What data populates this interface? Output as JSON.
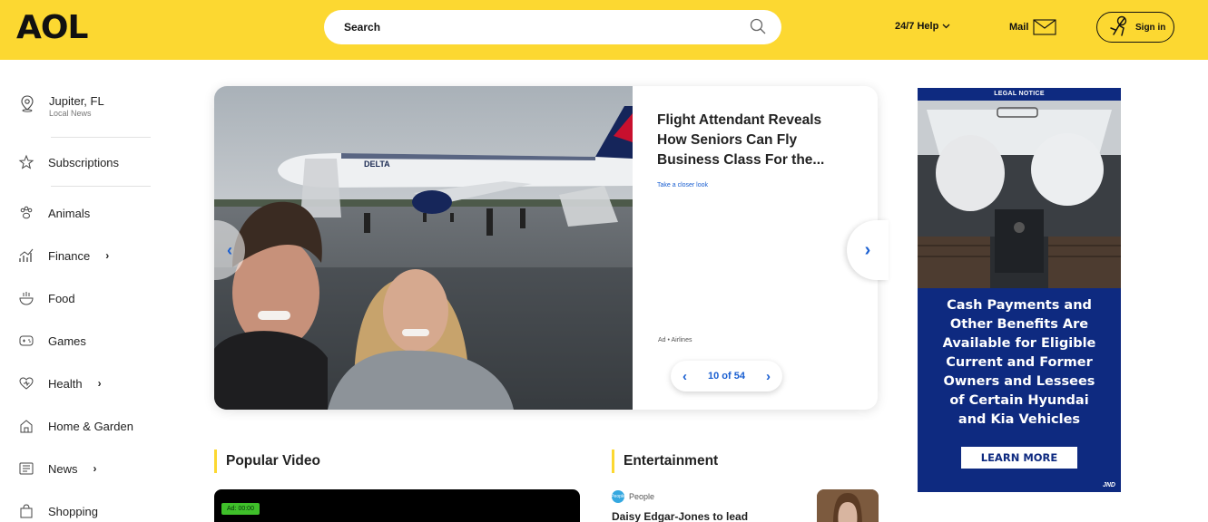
{
  "header": {
    "logo": "AOL",
    "search_placeholder": "Search",
    "help_label": "24/7 Help",
    "mail_label": "Mail",
    "signin_label": "Sign in",
    "colors": {
      "bg": "#fcd831"
    }
  },
  "sidebar": {
    "location": {
      "city": "Jupiter, FL",
      "sub": "Local News"
    },
    "subscriptions": "Subscriptions",
    "items": [
      {
        "label": "Animals",
        "icon": "paw-icon",
        "has_chevron": false
      },
      {
        "label": "Finance",
        "icon": "finance-chart-icon",
        "has_chevron": true
      },
      {
        "label": "Food",
        "icon": "bowl-icon",
        "has_chevron": false
      },
      {
        "label": "Games",
        "icon": "gamepad-icon",
        "has_chevron": false
      },
      {
        "label": "Health",
        "icon": "heart-icon",
        "has_chevron": true
      },
      {
        "label": "Home & Garden",
        "icon": "house-icon",
        "has_chevron": false
      },
      {
        "label": "News",
        "icon": "newspaper-icon",
        "has_chevron": true
      },
      {
        "label": "Shopping",
        "icon": "shopping-bag-icon",
        "has_chevron": false
      }
    ],
    "chevron": "›"
  },
  "carousel": {
    "title": "Flight Attendant Reveals How Seniors Can Fly Business Class For the...",
    "link": "Take a closer look",
    "ad_label": "Ad • Airlines",
    "pager": "10 of 54",
    "airline_livery": "DELTA"
  },
  "sections": {
    "popular_video": "Popular Video",
    "ad_timer": "Ad: 00:00",
    "entertainment": "Entertainment",
    "ent_source": "People",
    "ent_source_badge": "People",
    "ent_title": "Daisy Edgar-Jones to lead"
  },
  "right_ad": {
    "notice": "LEGAL NOTICE",
    "copy": [
      "Cash Payments and",
      "Other Benefits Are",
      "Available for Eligible",
      "Current and Former",
      "Owners and Lessees",
      "of Certain Hyundai",
      "and Kia Vehicles"
    ],
    "cta": "LEARN MORE",
    "brand": "JND",
    "bg_color": "#0e2a80"
  }
}
